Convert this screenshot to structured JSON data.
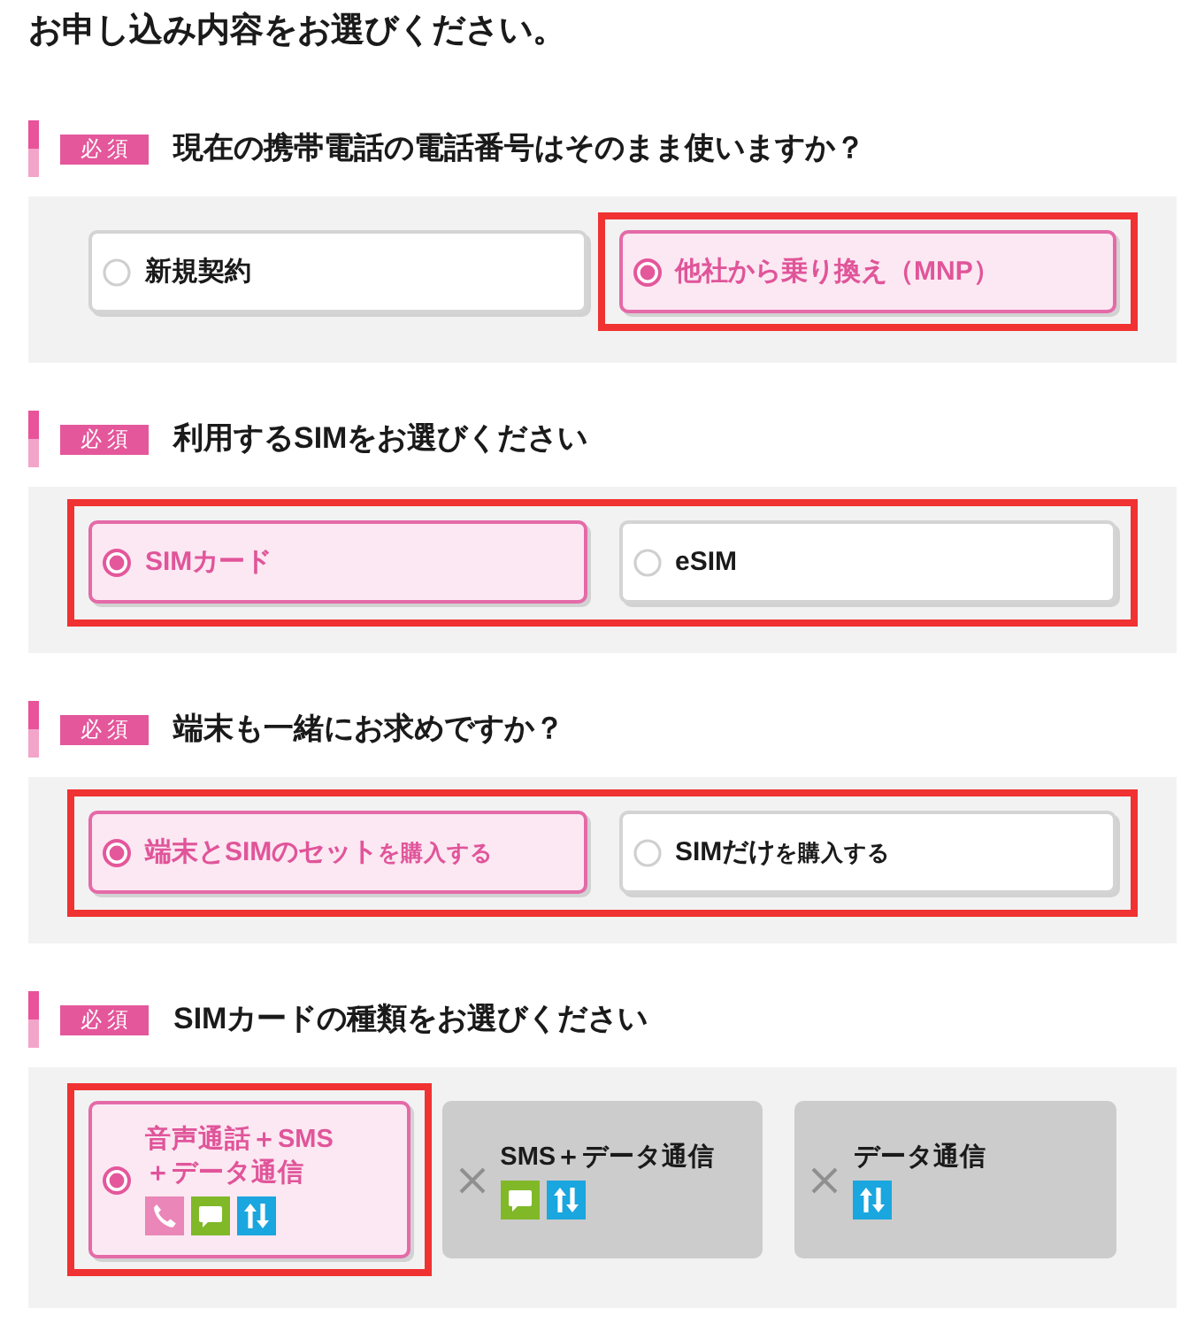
{
  "page_title": "お申し込み内容をお選びください。",
  "sections": [
    {
      "badge": "必須",
      "question": "現在の携帯電話の電話番号はそのまま使いますか？",
      "group_highlighted": false,
      "options": [
        {
          "label": "新規契約",
          "selected": false,
          "highlighted": false
        },
        {
          "label": "他社から乗り換え（MNP）",
          "selected": true,
          "highlighted": true
        }
      ]
    },
    {
      "badge": "必須",
      "question": "利用するSIMをお選びください",
      "group_highlighted": true,
      "options": [
        {
          "label": "SIMカード",
          "selected": true,
          "highlighted": false
        },
        {
          "label": "eSIM",
          "selected": false,
          "highlighted": false
        }
      ]
    },
    {
      "badge": "必須",
      "question": "端末も一緒にお求めですか？",
      "group_highlighted": true,
      "options": [
        {
          "label": "端末とSIMのセット",
          "note": "を購入する",
          "selected": true,
          "highlighted": false
        },
        {
          "label": "SIMだけ",
          "note": "を購入する",
          "selected": false,
          "highlighted": false
        }
      ]
    },
    {
      "badge": "必須",
      "question": "SIMカードの種類をお選びください",
      "group_highlighted": false,
      "options": [
        {
          "label": "音声通話＋SMS\n＋データ通信",
          "selected": true,
          "highlighted": true,
          "disabled": false,
          "icons": [
            {
              "kind": "voice"
            },
            {
              "kind": "sms"
            },
            {
              "kind": "data"
            }
          ]
        },
        {
          "label": "SMS＋データ通信",
          "selected": false,
          "highlighted": false,
          "disabled": true,
          "icons": [
            {
              "kind": "sms"
            },
            {
              "kind": "data"
            }
          ]
        },
        {
          "label": "データ通信",
          "selected": false,
          "highlighted": false,
          "disabled": true,
          "icons": [
            {
              "kind": "data"
            }
          ]
        }
      ]
    }
  ]
}
